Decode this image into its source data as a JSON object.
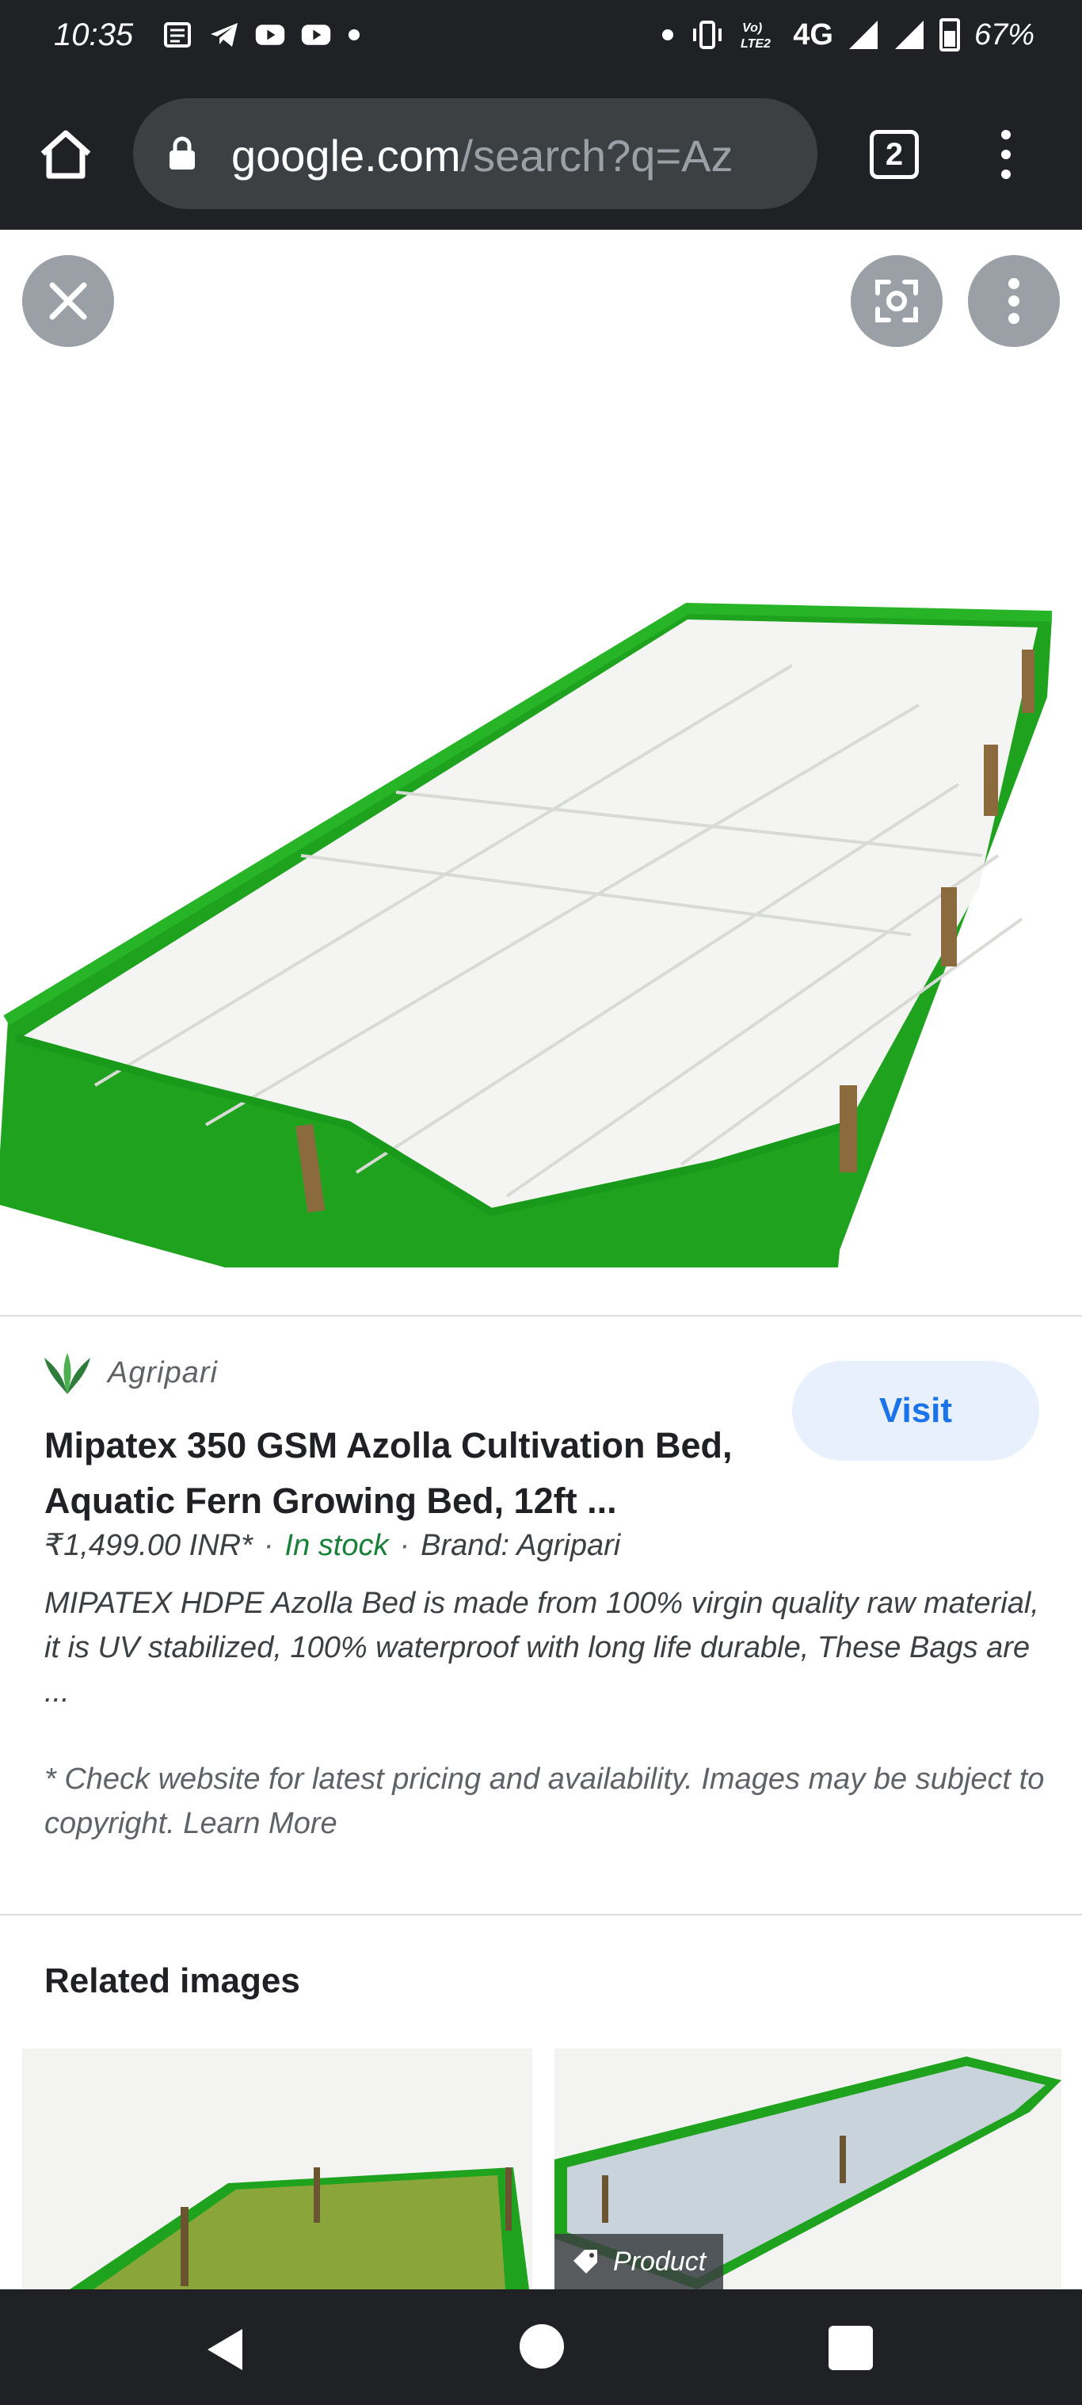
{
  "status_bar": {
    "time": "10:35",
    "network": "4G",
    "battery": "67%",
    "icons_left": [
      "news-icon",
      "telegram-icon",
      "youtube-icon",
      "youtube-icon",
      "dot-icon"
    ],
    "icons_right": [
      "dot-icon",
      "vibrate-icon",
      "volte-icon",
      "signal-icon",
      "signal-icon",
      "battery-icon"
    ]
  },
  "browser": {
    "url_host": "google.com",
    "url_path": "/search?q=Az",
    "tab_count": "2"
  },
  "viewer": {
    "buttons": [
      "close-icon",
      "lens-icon",
      "more-vert-icon"
    ]
  },
  "result": {
    "source_name": "Agripari",
    "visit_label": "Visit",
    "title": "Mipatex 350 GSM Azolla Cultivation Bed, Aquatic Fern Growing Bed, 12ft ...",
    "price": "₹1,499.00 INR*",
    "stock": "In stock",
    "brand": "Brand: Agripari",
    "description": "MIPATEX HDPE Azolla Bed is made from 100% virgin quality raw material, it is UV stabilized, 100% waterproof with long life durable, These Bags are ...",
    "disclaimer": "* Check website for latest pricing and availability. Images may be subject to copyright. Learn More"
  },
  "related": {
    "title": "Related images",
    "badge": "Product"
  },
  "colors": {
    "accent": "#1a73e8",
    "in_stock": "#188038",
    "bed_green": "#22a822",
    "dark_bar": "#202124"
  }
}
